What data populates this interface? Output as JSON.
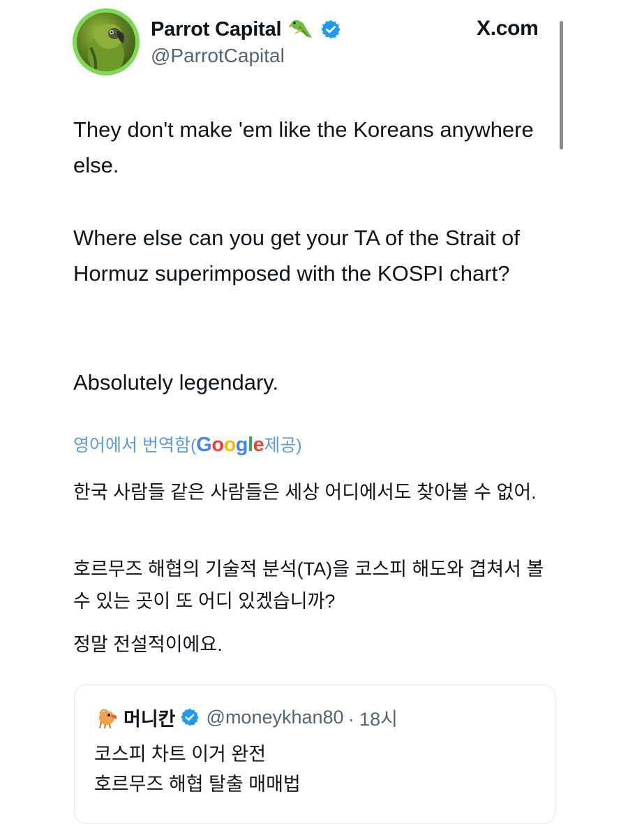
{
  "header": {
    "display_name": "Parrot Capital",
    "handle": "@ParrotCapital",
    "site": "X.com"
  },
  "tweet": {
    "paragraph_1": "They don't make 'em like the Koreans anywhere else.",
    "paragraph_2": "Where else can you get your TA of the Strait of Hormuz superimposed with the KOSPI chart?",
    "paragraph_3": "Absolutely legendary."
  },
  "translation": {
    "prefix": "영어에서 번역함(",
    "provider": "Google",
    "suffix": " 제공)",
    "paragraph_1": "한국 사람들 같은 사람들은 세상 어디에서도 찾아볼 수 없어.",
    "paragraph_2": "호르무즈 해협의 기술적 분석(TA)을 코스피 해도와 겹쳐서 볼 수 있는 곳이 또 어디 있겠습니까?",
    "paragraph_3": "정말 전설적이에요."
  },
  "quote": {
    "name": "머니칸",
    "handle": "@moneykhan80",
    "time": "· 18시",
    "line_1": "코스피 차트 이거 완전",
    "line_2": "호르무즈 해협 탈출 매매법"
  },
  "icons": {
    "avatar": "parrot-avatar",
    "emoji": "parrot-emoji-icon",
    "verified": "verified-badge-icon",
    "quote_avatar": "parrot-mascot-icon"
  },
  "colors": {
    "verified": "#1d9bf0",
    "link": "#5b9bd5",
    "secondary_text": "#536471",
    "avatar_ring": "#7ed957"
  }
}
